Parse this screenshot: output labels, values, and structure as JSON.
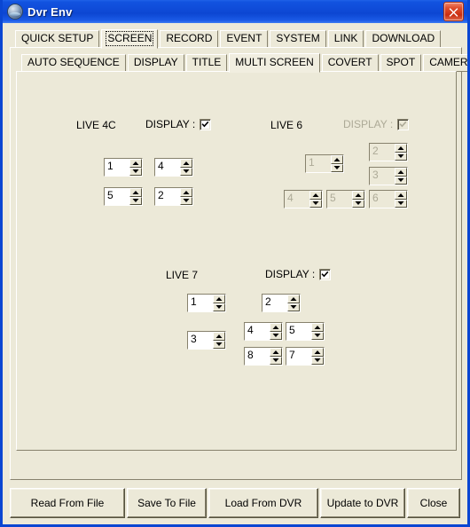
{
  "window": {
    "title": "Dvr Env",
    "icon": "app-globe-icon",
    "close_label": "✕",
    "border_color": "#0a46d2",
    "face_color": "#ece9d8"
  },
  "primary_tabs": [
    {
      "label": "QUICK SETUP",
      "selected": false
    },
    {
      "label": "SCREEN",
      "selected": true
    },
    {
      "label": "RECORD",
      "selected": false
    },
    {
      "label": "EVENT",
      "selected": false
    },
    {
      "label": "SYSTEM",
      "selected": false
    },
    {
      "label": "LINK",
      "selected": false
    },
    {
      "label": "DOWNLOAD",
      "selected": false
    }
  ],
  "secondary_tabs": [
    {
      "label": "AUTO SEQUENCE",
      "selected": false
    },
    {
      "label": "DISPLAY",
      "selected": false
    },
    {
      "label": "TITLE",
      "selected": false
    },
    {
      "label": "MULTI SCREEN",
      "selected": true
    },
    {
      "label": "COVERT",
      "selected": false
    },
    {
      "label": "SPOT",
      "selected": false
    },
    {
      "label": "CAMERA",
      "selected": false
    }
  ],
  "groups": {
    "live4c": {
      "title": "LIVE 4C",
      "display_label": "DISPLAY :",
      "display_checked": true,
      "enabled": true,
      "cells": [
        {
          "id": "live4c-cell-1",
          "value": "1"
        },
        {
          "id": "live4c-cell-2",
          "value": "4"
        },
        {
          "id": "live4c-cell-3",
          "value": "5"
        },
        {
          "id": "live4c-cell-4",
          "value": "2"
        }
      ]
    },
    "live6": {
      "title": "LIVE 6",
      "display_label": "DISPLAY :",
      "display_checked": true,
      "enabled": false,
      "cells": [
        {
          "id": "live6-cell-1",
          "value": "1"
        },
        {
          "id": "live6-cell-2",
          "value": "2"
        },
        {
          "id": "live6-cell-3",
          "value": "3"
        },
        {
          "id": "live6-cell-4",
          "value": "4"
        },
        {
          "id": "live6-cell-5",
          "value": "5"
        },
        {
          "id": "live6-cell-6",
          "value": "6"
        }
      ]
    },
    "live7": {
      "title": "LIVE 7",
      "display_label": "DISPLAY :",
      "display_checked": true,
      "enabled": true,
      "cells": [
        {
          "id": "live7-cell-1",
          "value": "1"
        },
        {
          "id": "live7-cell-2",
          "value": "2"
        },
        {
          "id": "live7-cell-3",
          "value": "3"
        },
        {
          "id": "live7-cell-4",
          "value": "4"
        },
        {
          "id": "live7-cell-5",
          "value": "5"
        },
        {
          "id": "live7-cell-6",
          "value": "8"
        },
        {
          "id": "live7-cell-7",
          "value": "7"
        }
      ]
    }
  },
  "buttons": [
    {
      "label": "Read From File"
    },
    {
      "label": "Save To File"
    },
    {
      "label": "Load From DVR"
    },
    {
      "label": "Update to DVR"
    },
    {
      "label": "Close"
    }
  ]
}
